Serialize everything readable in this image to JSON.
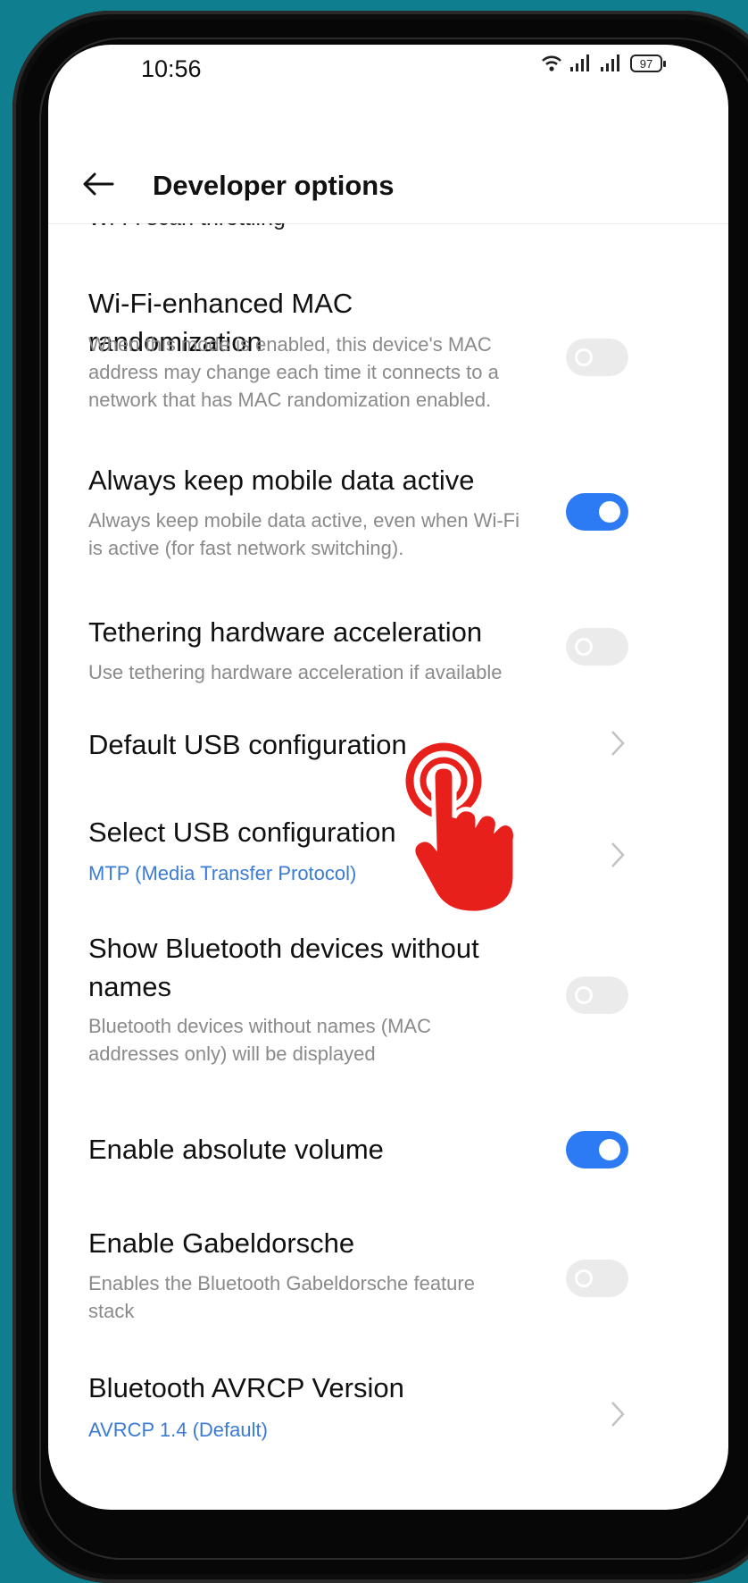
{
  "status_bar": {
    "time": "10:56",
    "battery": "97"
  },
  "header": {
    "title": "Developer options"
  },
  "list": {
    "partial_item": "Wi-Fi scan throttling",
    "items": [
      {
        "title": "Wi-Fi-enhanced MAC randomization",
        "subtitle_lines": [
          "When this mode is enabled, this device's MAC",
          "address may change each time it connects to a",
          "network that has MAC randomization enabled."
        ],
        "control": "toggle",
        "state": "off"
      },
      {
        "title": "Always keep mobile data active",
        "subtitle_lines": [
          "Always keep mobile data active, even when Wi-Fi",
          "is active (for fast network switching)."
        ],
        "control": "toggle",
        "state": "on"
      },
      {
        "title": "Tethering hardware acceleration",
        "subtitle_lines": [
          "Use tethering hardware acceleration if available"
        ],
        "control": "toggle",
        "state": "off"
      },
      {
        "title": "Default USB configuration",
        "control": "chevron"
      },
      {
        "title": "Select USB configuration",
        "value": "MTP (Media Transfer Protocol)",
        "control": "chevron"
      },
      {
        "title_lines": [
          "Show Bluetooth devices without",
          "names"
        ],
        "subtitle_lines": [
          "Bluetooth devices without names (MAC",
          "addresses only) will be displayed"
        ],
        "control": "toggle",
        "state": "off"
      },
      {
        "title": "Enable absolute volume",
        "control": "toggle",
        "state": "on"
      },
      {
        "title": "Enable Gabeldorsche",
        "subtitle_lines": [
          "Enables the Bluetooth Gabeldorsche feature",
          "stack"
        ],
        "control": "toggle",
        "state": "off"
      },
      {
        "title": "Bluetooth AVRCP Version",
        "value": "AVRCP 1.4 (Default)",
        "control": "chevron"
      }
    ]
  },
  "colors": {
    "accent": "#2d7bf4",
    "link": "#3a7bd5",
    "background": "#0f7f8f",
    "hand": "#e8201c"
  },
  "icons": {
    "back": "arrow-left-icon",
    "chevron": "chevron-right-icon",
    "wifi": "wifi-icon",
    "signal": "signal-icon",
    "battery": "battery-icon",
    "hand": "tap-hand-icon"
  }
}
